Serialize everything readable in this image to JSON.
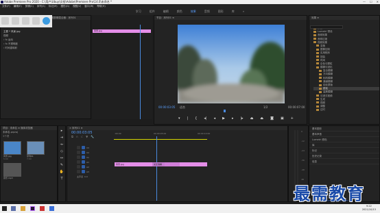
{
  "titlebar": {
    "title": "Adobe Premiere Pro 2020 - C:\\用户\\Ubuy\\文档\\Adobe\\Premiere Pro\\14.0\\未命名 *",
    "min": "—",
    "max": "☐",
    "close": "✕"
  },
  "menu": [
    "文件(F)",
    "编辑(E)",
    "剪辑(C)",
    "序列(S)",
    "标记(M)",
    "图形(G)",
    "视图(V)",
    "窗口(W)",
    "帮助(H)"
  ],
  "workspaces": [
    {
      "label": "学习"
    },
    {
      "label": "组件"
    },
    {
      "label": "编辑"
    },
    {
      "label": "颜色"
    },
    {
      "label": "效果",
      "active": true
    },
    {
      "label": "音频"
    },
    {
      "label": "图形"
    },
    {
      "label": "库"
    },
    {
      "label": "»"
    }
  ],
  "effect_controls": {
    "header": "效果控件 ≡   Lumetri 范围   源：（无剪辑）   音频剪辑混合器：序列01",
    "source_label": "主要 * 风景.jpg",
    "sequence_label": "序列01 * 风景.jpg",
    "section": "视频",
    "rows": [
      "› fx  运动",
      "› fx  不透明度",
      "› 时间重映射"
    ]
  },
  "clip_label": "风景.jpg",
  "program": {
    "header": "节目：序列01 ≡",
    "timecode": "00:00:03:05",
    "fit": "适合",
    "ratio": "1/2",
    "duration": "00:00:07:00"
  },
  "effects": {
    "header": "效果 ≡",
    "items": [
      {
        "label": "预设",
        "indent": 0
      },
      {
        "label": "Lumetri 预设",
        "indent": 0
      },
      {
        "label": "音频效果",
        "indent": 0
      },
      {
        "label": "音频过渡",
        "indent": 0
      },
      {
        "label": "视频效果",
        "indent": 0
      },
      {
        "label": "变换",
        "indent": 1
      },
      {
        "label": "图像控制",
        "indent": 1
      },
      {
        "label": "实用程序",
        "indent": 1
      },
      {
        "label": "扭曲",
        "indent": 1
      },
      {
        "label": "时间",
        "indent": 1
      },
      {
        "label": "杂色与颗粒",
        "indent": 1
      },
      {
        "label": "模糊与锐化",
        "indent": 1
      },
      {
        "label": "复合模糊",
        "indent": 2
      },
      {
        "label": "方向模糊",
        "indent": 2
      },
      {
        "label": "相机模糊",
        "indent": 2
      },
      {
        "label": "通道模糊",
        "indent": 2
      },
      {
        "label": "钝化蒙版",
        "indent": 2
      },
      {
        "label": "锐化",
        "indent": 2,
        "highlight": true
      },
      {
        "label": "高斯模糊",
        "indent": 2
      },
      {
        "label": "沉浸式视频",
        "indent": 1
      },
      {
        "label": "生成",
        "indent": 1
      },
      {
        "label": "视频",
        "indent": 1
      },
      {
        "label": "调整",
        "indent": 1
      },
      {
        "label": "过时",
        "indent": 1
      }
    ]
  },
  "lower_right": [
    "基本图形",
    "基本声音",
    "Lumetri 颜色",
    "库",
    "标记",
    "历史记录",
    "信息"
  ],
  "project": {
    "header": "项目：未命名 ≡   媒体浏览器",
    "name": "未命名.prproj",
    "count": "3个项",
    "items": [
      {
        "label": "风景.jpg",
        "duration": "5:00"
      },
      {
        "label": "序列01",
        "duration": "7:00"
      },
      {
        "label": "音乐.mp3",
        "duration": ""
      }
    ]
  },
  "timeline": {
    "header": "× 序列01 ≡",
    "timecode": "00:00:03:05",
    "ruler": [
      ":00:00",
      "00:00:05:00",
      "00:00:10:00"
    ],
    "tracks": [
      "V3",
      "V2",
      "V1",
      "A1",
      "A2",
      "A3"
    ],
    "master": "主声道",
    "master_val": "0.0",
    "clips": [
      {
        "label": "风景.jpg"
      },
      {
        "label": "风景.jpg"
      },
      {
        "label": "交叉溶解"
      }
    ]
  },
  "meters": {
    "labels": [
      "0",
      "-12",
      "-24",
      "-36",
      "-48",
      "dB"
    ]
  },
  "taskbar": {
    "time": "9:22",
    "date": "2021/10/13"
  },
  "watermark": {
    "text": "最需教育",
    "url": "www.zxjiaoyu.com"
  }
}
